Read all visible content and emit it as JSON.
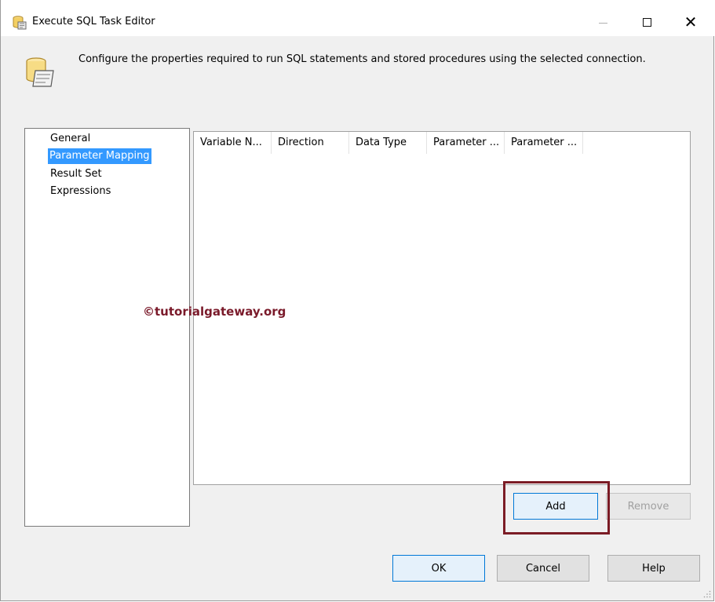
{
  "window": {
    "title": "Execute SQL Task Editor",
    "controls": {
      "minimize_icon": "minimize-icon",
      "maximize_icon": "maximize-icon",
      "close_glyph": "✕"
    }
  },
  "header": {
    "description": "Configure the properties required to run SQL statements and stored procedures using the selected connection."
  },
  "nav": {
    "items": [
      {
        "label": "General",
        "selected": false
      },
      {
        "label": "Parameter Mapping",
        "selected": true
      },
      {
        "label": "Result Set",
        "selected": false
      },
      {
        "label": "Expressions",
        "selected": false
      }
    ]
  },
  "grid": {
    "columns": [
      "Variable N...",
      "Direction",
      "Data Type",
      "Parameter ...",
      "Parameter ..."
    ]
  },
  "watermark": "©tutorialgateway.org",
  "buttons": {
    "add": "Add",
    "remove": "Remove",
    "ok": "OK",
    "cancel": "Cancel",
    "help": "Help"
  },
  "colors": {
    "selection": "#3399ff",
    "highlight_box": "#7b1c25",
    "watermark": "#7a1a2a",
    "focus_border": "#0078d7"
  }
}
